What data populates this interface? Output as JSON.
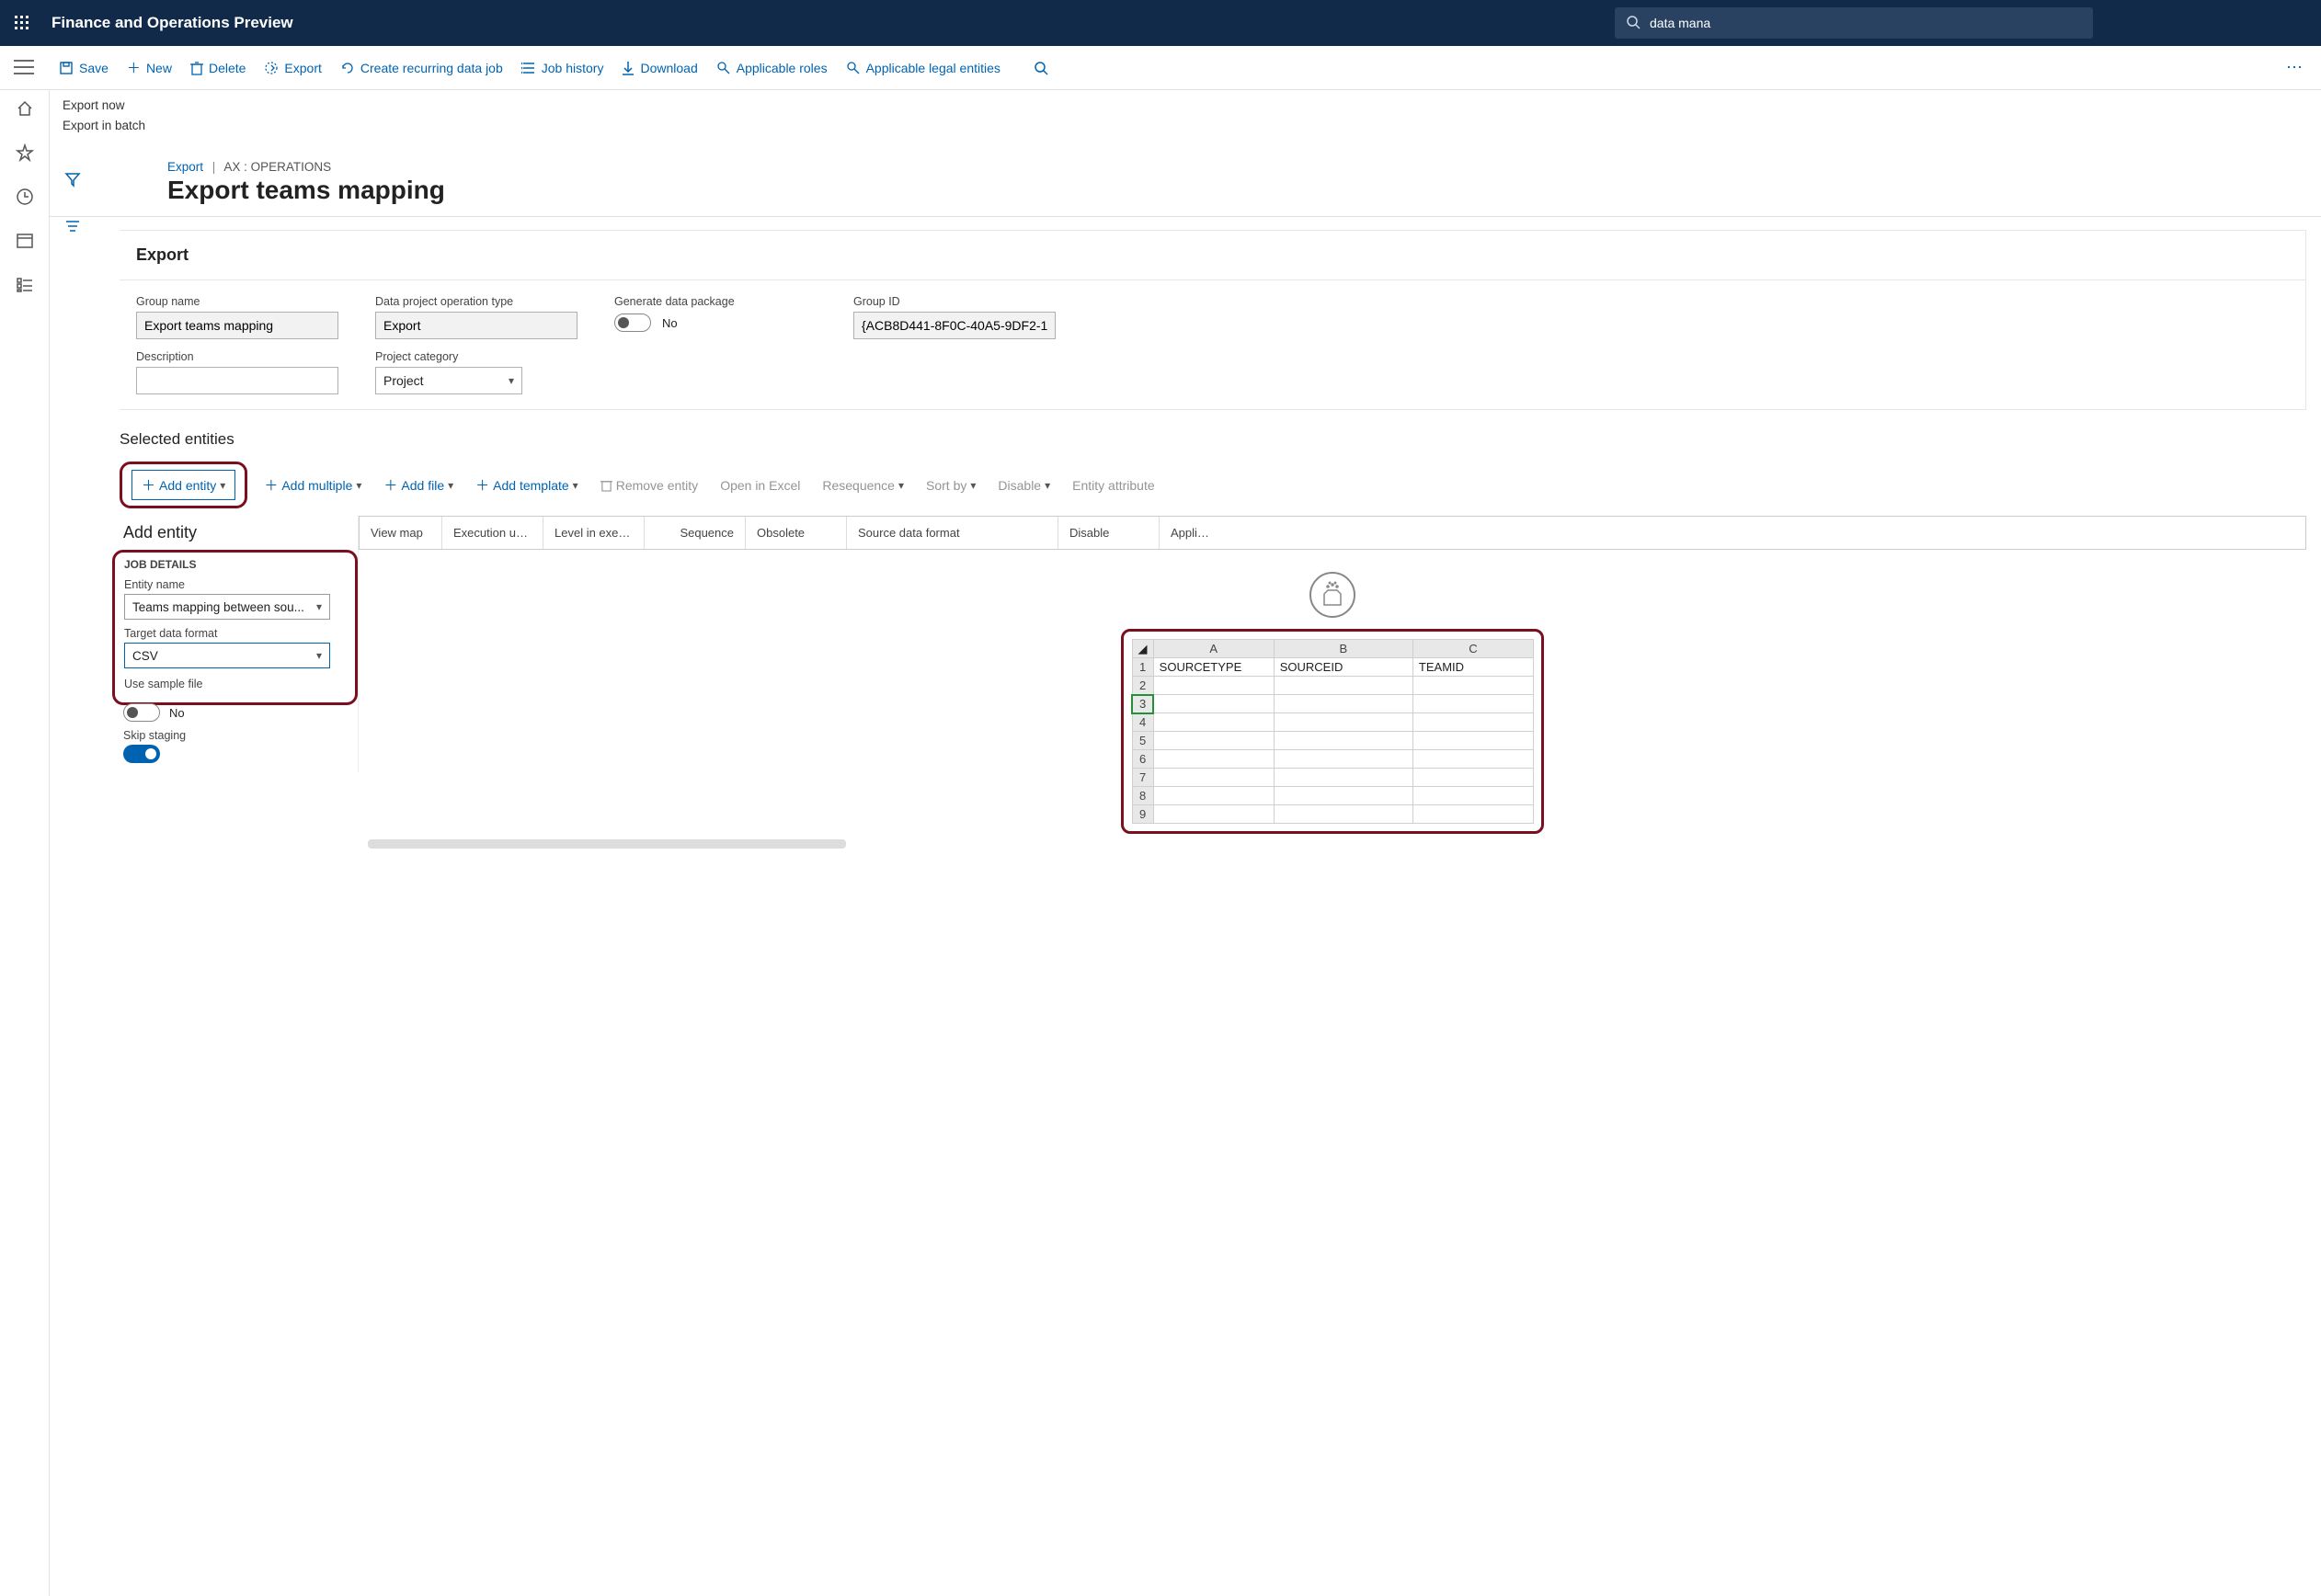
{
  "topbar": {
    "app_title": "Finance and Operations Preview",
    "search_value": "data mana"
  },
  "commands": {
    "save": "Save",
    "new": "New",
    "delete": "Delete",
    "export": "Export",
    "create_recurring": "Create recurring data job",
    "job_history": "Job history",
    "download": "Download",
    "applicable_roles": "Applicable roles",
    "applicable_legal": "Applicable legal entities"
  },
  "subcommands": {
    "export_now": "Export now",
    "export_batch": "Export in batch"
  },
  "breadcrumb": {
    "link": "Export",
    "crumb": "AX : OPERATIONS"
  },
  "page_title": "Export teams mapping",
  "export_panel": {
    "heading": "Export",
    "group_name_label": "Group name",
    "group_name_value": "Export teams mapping",
    "operation_type_label": "Data project operation type",
    "operation_type_value": "Export",
    "description_label": "Description",
    "description_value": "",
    "project_category_label": "Project category",
    "project_category_value": "Project",
    "generate_label": "Generate data package",
    "generate_value": "No",
    "group_id_label": "Group ID",
    "group_id_value": "{ACB8D441-8F0C-40A5-9DF2-1..."
  },
  "selected_entities": {
    "heading": "Selected entities",
    "add_entity": "Add entity",
    "add_multiple": "Add multiple",
    "add_file": "Add file",
    "add_template": "Add template",
    "remove_entity": "Remove entity",
    "open_excel": "Open in Excel",
    "resequence": "Resequence",
    "sort_by": "Sort by",
    "disable": "Disable",
    "entity_attribute": "Entity attribute"
  },
  "grid_columns": {
    "view_map": "View map",
    "execution_unit": "Execution unit",
    "level_exec": "Level in executi...",
    "sequence": "Sequence",
    "obsolete": "Obsolete",
    "source_format": "Source data format",
    "disable": "Disable",
    "applicat": "Applicat"
  },
  "add_entity_popup": {
    "title": "Add entity",
    "job_details": "JOB DETAILS",
    "entity_name_label": "Entity name",
    "entity_name_value": "Teams mapping between sou...",
    "target_format_label": "Target data format",
    "target_format_value": "CSV",
    "use_sample_label": "Use sample file",
    "use_sample_value": "No",
    "skip_staging_label": "Skip staging"
  },
  "excel": {
    "cols": [
      "A",
      "B",
      "C"
    ],
    "row1": {
      "a": "SOURCETYPE",
      "b": "SOURCEID",
      "c": "TEAMID"
    },
    "rows": [
      "1",
      "2",
      "3",
      "4",
      "5",
      "6",
      "7",
      "8",
      "9"
    ]
  }
}
